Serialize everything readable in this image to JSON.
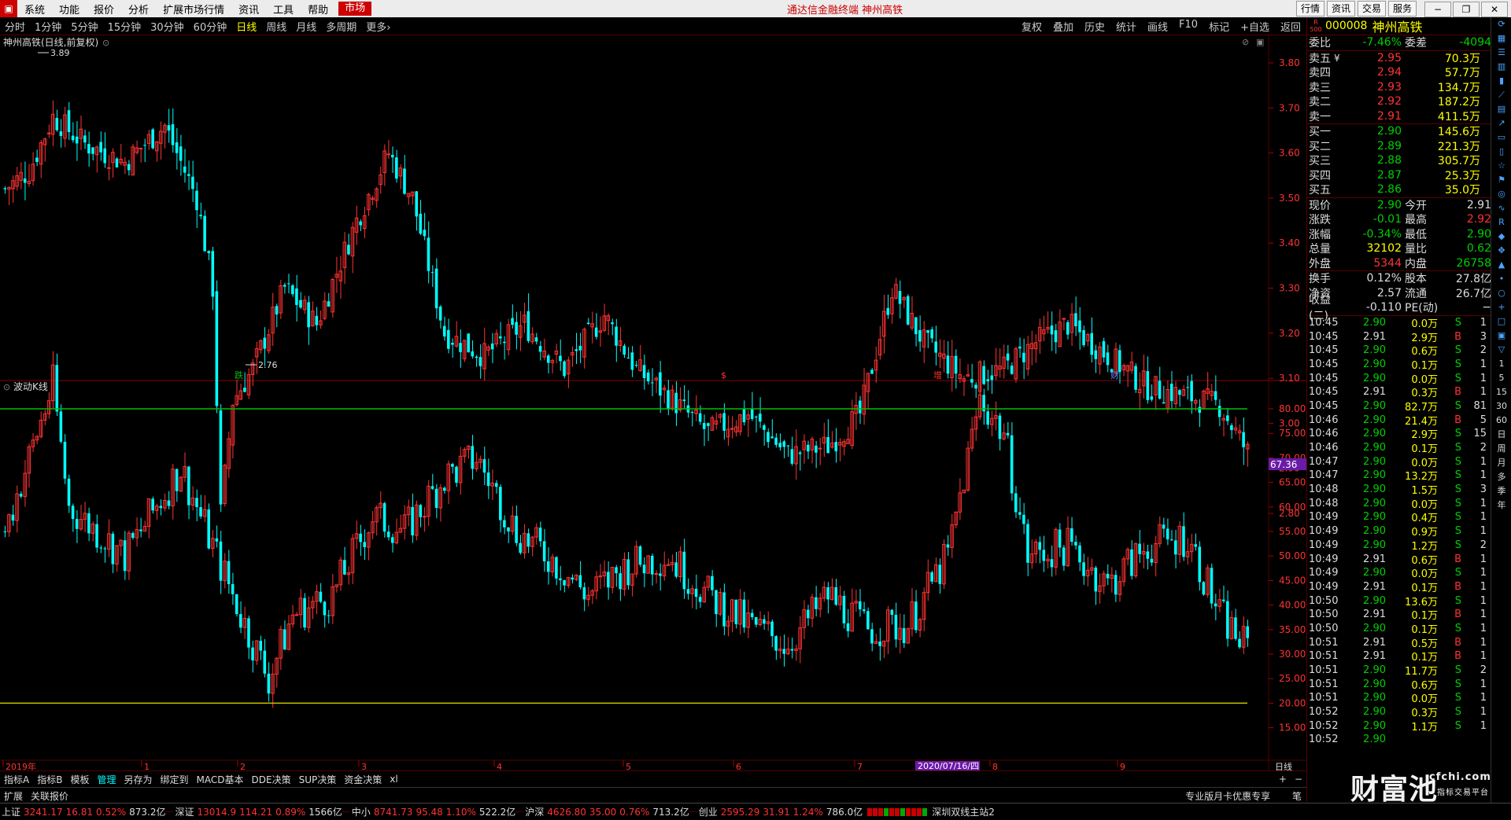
{
  "menu": {
    "items": [
      "系统",
      "功能",
      "报价",
      "分析",
      "扩展市场行情",
      "资讯",
      "工具",
      "帮助"
    ],
    "market": "市场",
    "app_title": "通达信金融终端  神州高铁",
    "right_buttons": [
      "行情",
      "资讯",
      "交易",
      "服务"
    ]
  },
  "period_bar": {
    "items": [
      "分时",
      "1分钟",
      "5分钟",
      "15分钟",
      "30分钟",
      "60分钟",
      "日线",
      "周线",
      "月线",
      "多周期",
      "更多"
    ],
    "active": "日线",
    "more_arrow": "›",
    "right_items": [
      "复权",
      "叠加",
      "历史",
      "统计",
      "画线",
      "F10",
      "标记",
      "+自选",
      "返回"
    ]
  },
  "main_chart": {
    "title": "神州高铁(日线,前复权)",
    "price_axis": [
      "3.80",
      "3.70",
      "3.60",
      "3.50",
      "3.40",
      "3.30",
      "3.20",
      "3.10",
      "3.00",
      "2.90",
      "2.80"
    ],
    "high_label": "3.89",
    "low_label": "2.76",
    "markers": [
      "跌",
      "$",
      "增",
      "财"
    ]
  },
  "indicator": {
    "title": "波动K线",
    "axis": [
      "80.00",
      "75.00",
      "70.00",
      "65.00",
      "60.00",
      "55.00",
      "50.00",
      "45.00",
      "40.00",
      "35.00",
      "30.00",
      "25.00",
      "20.00",
      "15.00"
    ],
    "current_value": "67.36",
    "upper_line": 80,
    "lower_line": 20
  },
  "time_axis": {
    "labels": [
      "2019年",
      "1",
      "2",
      "3",
      "4",
      "5",
      "6",
      "7",
      "8",
      "9"
    ],
    "cursor_date": "2020/07/16/四",
    "period_label": "日线"
  },
  "bottom_tabs": {
    "items": [
      "指标A",
      "指标B",
      "模板",
      "管理",
      "另存为",
      "绑定到",
      "MACD基本",
      "DDE决策",
      "SUP决策",
      "资金决策",
      "xl"
    ],
    "active": "管理",
    "right": [
      "+",
      "−"
    ]
  },
  "ext_bar": {
    "items": [
      "扩展",
      "关联报价"
    ],
    "promo": "专业版月卡优惠专享",
    "brush": "笔"
  },
  "ticker": [
    {
      "name": "上证",
      "val": "3241.17",
      "chg": "16.81",
      "pct": "0.52%",
      "amt": "873.2亿"
    },
    {
      "name": "深证",
      "val": "13014.9",
      "chg": "114.21",
      "pct": "0.89%",
      "amt": "1566亿"
    },
    {
      "name": "中小",
      "val": "8741.73",
      "chg": "95.48",
      "pct": "1.10%",
      "amt": "522.2亿"
    },
    {
      "name": "沪深",
      "val": "4626.80",
      "chg": "35.00",
      "pct": "0.76%",
      "amt": "713.2亿"
    },
    {
      "name": "创业",
      "val": "2595.29",
      "chg": "31.91",
      "pct": "1.24%",
      "amt": "786.0亿"
    }
  ],
  "ticker_broadcast": "深圳双线主站2",
  "stock": {
    "badge": "R 500",
    "code": "000008",
    "name": "神州高铁"
  },
  "order_book": {
    "weibi_label": "委比",
    "weibi": "-7.46%",
    "weicha_label": "委差",
    "weicha": "-4094",
    "asks": [
      {
        "label": "卖五",
        "price": "2.95",
        "vol": "70.3万"
      },
      {
        "label": "卖四",
        "price": "2.94",
        "vol": "57.7万"
      },
      {
        "label": "卖三",
        "price": "2.93",
        "vol": "134.7万"
      },
      {
        "label": "卖二",
        "price": "2.92",
        "vol": "187.2万"
      },
      {
        "label": "卖一",
        "price": "2.91",
        "vol": "411.5万"
      }
    ],
    "ask5_currency": "¥",
    "bids": [
      {
        "label": "买一",
        "price": "2.90",
        "vol": "145.6万"
      },
      {
        "label": "买二",
        "price": "2.89",
        "vol": "221.3万"
      },
      {
        "label": "买三",
        "price": "2.88",
        "vol": "305.7万"
      },
      {
        "label": "买四",
        "price": "2.87",
        "vol": "25.3万"
      },
      {
        "label": "买五",
        "price": "2.86",
        "vol": "35.0万"
      }
    ]
  },
  "quote": [
    {
      "l1": "现价",
      "v1": "2.90",
      "c1": "grn",
      "l2": "今开",
      "v2": "2.91",
      "c2": "wht"
    },
    {
      "l1": "涨跌",
      "v1": "-0.01",
      "c1": "grn",
      "l2": "最高",
      "v2": "2.92",
      "c2": "red"
    },
    {
      "l1": "涨幅",
      "v1": "-0.34%",
      "c1": "grn",
      "l2": "最低",
      "v2": "2.90",
      "c2": "grn"
    },
    {
      "l1": "总量",
      "v1": "32102",
      "c1": "yel",
      "l2": "量比",
      "v2": "0.62",
      "c2": "grn"
    },
    {
      "l1": "外盘",
      "v1": "5344",
      "c1": "red",
      "l2": "内盘",
      "v2": "26758",
      "c2": "grn"
    },
    {
      "l1": "换手",
      "v1": "0.12%",
      "c1": "wht",
      "l2": "股本",
      "v2": "27.8亿",
      "c2": "wht"
    },
    {
      "l1": "净资",
      "v1": "2.57",
      "c1": "wht",
      "l2": "流通",
      "v2": "26.7亿",
      "c2": "wht"
    },
    {
      "l1": "收益(二)",
      "v1": "-0.110",
      "c1": "wht",
      "l2": "PE(动)",
      "v2": "−",
      "c2": "wht"
    }
  ],
  "trades": [
    {
      "t": "10:45",
      "p": "2.90",
      "pc": "grn",
      "v": "0.0万",
      "vc": "yel",
      "bs": "S",
      "n": "1"
    },
    {
      "t": "10:45",
      "p": "2.91",
      "pc": "wht",
      "v": "2.9万",
      "vc": "yel",
      "bs": "B",
      "n": "3"
    },
    {
      "t": "10:45",
      "p": "2.90",
      "pc": "grn",
      "v": "0.6万",
      "vc": "yel",
      "bs": "S",
      "n": "2"
    },
    {
      "t": "10:45",
      "p": "2.90",
      "pc": "grn",
      "v": "0.1万",
      "vc": "yel",
      "bs": "S",
      "n": "1"
    },
    {
      "t": "10:45",
      "p": "2.90",
      "pc": "grn",
      "v": "0.0万",
      "vc": "yel",
      "bs": "S",
      "n": "1"
    },
    {
      "t": "10:45",
      "p": "2.91",
      "pc": "wht",
      "v": "0.3万",
      "vc": "yel",
      "bs": "B",
      "n": "1"
    },
    {
      "t": "10:45",
      "p": "2.90",
      "pc": "grn",
      "v": "82.7万",
      "vc": "mag",
      "bs": "S",
      "n": "81"
    },
    {
      "t": "10:46",
      "p": "2.90",
      "pc": "grn",
      "v": "21.4万",
      "vc": "mag",
      "bs": "B",
      "n": "5"
    },
    {
      "t": "10:46",
      "p": "2.90",
      "pc": "grn",
      "v": "2.9万",
      "vc": "yel",
      "bs": "S",
      "n": "15"
    },
    {
      "t": "10:46",
      "p": "2.90",
      "pc": "grn",
      "v": "0.1万",
      "vc": "yel",
      "bs": "S",
      "n": "2"
    },
    {
      "t": "10:47",
      "p": "2.90",
      "pc": "grn",
      "v": "0.0万",
      "vc": "yel",
      "bs": "S",
      "n": "1"
    },
    {
      "t": "10:47",
      "p": "2.90",
      "pc": "grn",
      "v": "13.2万",
      "vc": "yel",
      "bs": "S",
      "n": "1"
    },
    {
      "t": "10:48",
      "p": "2.90",
      "pc": "grn",
      "v": "1.5万",
      "vc": "yel",
      "bs": "S",
      "n": "3"
    },
    {
      "t": "10:48",
      "p": "2.90",
      "pc": "grn",
      "v": "0.0万",
      "vc": "yel",
      "bs": "S",
      "n": "1"
    },
    {
      "t": "10:49",
      "p": "2.90",
      "pc": "grn",
      "v": "0.4万",
      "vc": "yel",
      "bs": "S",
      "n": "1"
    },
    {
      "t": "10:49",
      "p": "2.90",
      "pc": "grn",
      "v": "0.9万",
      "vc": "yel",
      "bs": "S",
      "n": "1"
    },
    {
      "t": "10:49",
      "p": "2.90",
      "pc": "grn",
      "v": "1.2万",
      "vc": "yel",
      "bs": "S",
      "n": "2"
    },
    {
      "t": "10:49",
      "p": "2.91",
      "pc": "wht",
      "v": "0.6万",
      "vc": "yel",
      "bs": "B",
      "n": "1"
    },
    {
      "t": "10:49",
      "p": "2.90",
      "pc": "grn",
      "v": "0.0万",
      "vc": "yel",
      "bs": "S",
      "n": "1"
    },
    {
      "t": "10:49",
      "p": "2.91",
      "pc": "wht",
      "v": "0.1万",
      "vc": "yel",
      "bs": "B",
      "n": "1"
    },
    {
      "t": "10:50",
      "p": "2.90",
      "pc": "grn",
      "v": "13.6万",
      "vc": "yel",
      "bs": "S",
      "n": "1"
    },
    {
      "t": "10:50",
      "p": "2.91",
      "pc": "wht",
      "v": "0.1万",
      "vc": "yel",
      "bs": "B",
      "n": "1"
    },
    {
      "t": "10:50",
      "p": "2.90",
      "pc": "grn",
      "v": "0.1万",
      "vc": "yel",
      "bs": "S",
      "n": "1"
    },
    {
      "t": "10:51",
      "p": "2.91",
      "pc": "wht",
      "v": "0.5万",
      "vc": "yel",
      "bs": "B",
      "n": "1"
    },
    {
      "t": "10:51",
      "p": "2.91",
      "pc": "wht",
      "v": "0.1万",
      "vc": "yel",
      "bs": "B",
      "n": "1"
    },
    {
      "t": "10:51",
      "p": "2.90",
      "pc": "grn",
      "v": "11.7万",
      "vc": "yel",
      "bs": "S",
      "n": "2"
    },
    {
      "t": "10:51",
      "p": "2.90",
      "pc": "grn",
      "v": "0.6万",
      "vc": "yel",
      "bs": "S",
      "n": "1"
    },
    {
      "t": "10:51",
      "p": "2.90",
      "pc": "grn",
      "v": "0.0万",
      "vc": "yel",
      "bs": "S",
      "n": "1"
    },
    {
      "t": "10:52",
      "p": "2.90",
      "pc": "grn",
      "v": "0.3万",
      "vc": "yel",
      "bs": "S",
      "n": "1"
    },
    {
      "t": "10:52",
      "p": "2.90",
      "pc": "grn",
      "v": "1.1万",
      "vc": "yel",
      "bs": "S",
      "n": "1"
    },
    {
      "t": "10:52",
      "p": "2.90",
      "pc": "grn",
      "v": "",
      "vc": "yel",
      "bs": "",
      "n": ""
    }
  ],
  "side_icons": [
    "1",
    "5",
    "15",
    "30",
    "60",
    "日",
    "周",
    "月",
    "多",
    "季",
    "年"
  ],
  "watermark": {
    "main": "财富池",
    "site": "cfchi.com",
    "sub": "指标交易平台"
  },
  "colors": {
    "up": "#ff3333",
    "down": "#00ffff",
    "bg": "#000000",
    "grid": "#550000",
    "upper_line": "#00c000",
    "lower_line": "#c8c800"
  }
}
